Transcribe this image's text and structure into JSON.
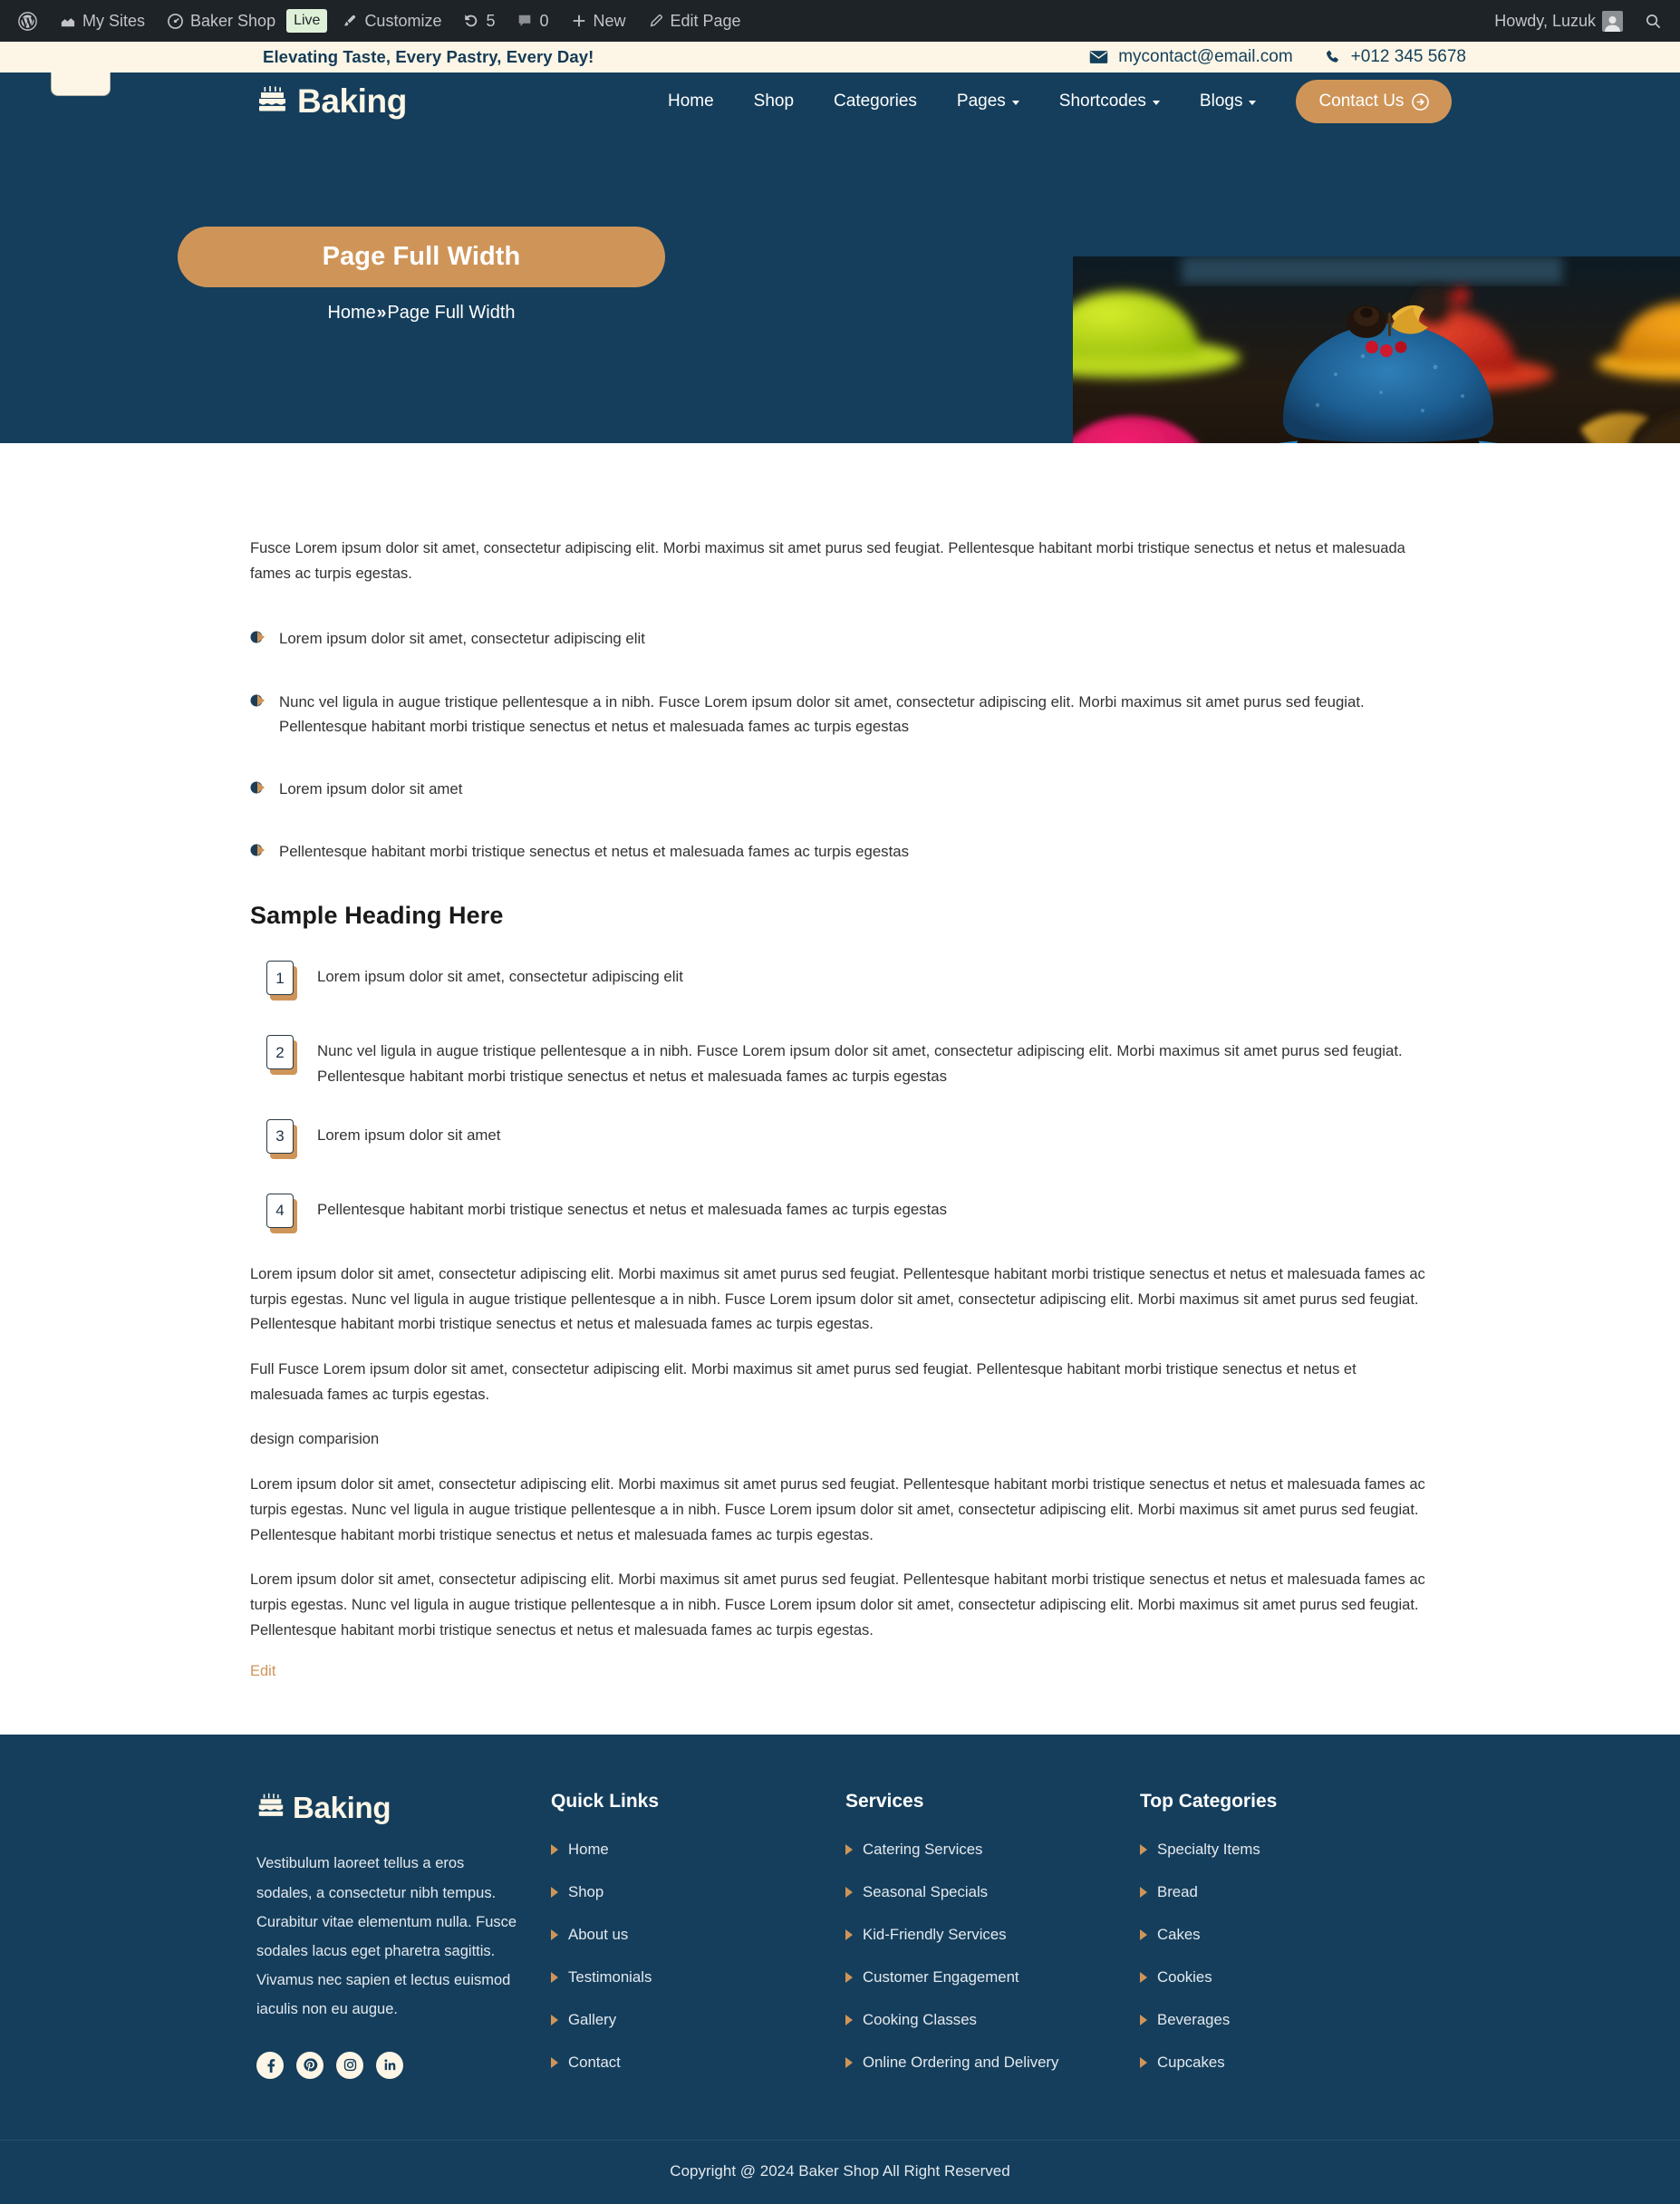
{
  "adminbar": {
    "items": [
      {
        "icon": "wordpress-icon",
        "label": ""
      },
      {
        "icon": "my-sites-icon",
        "label": "My Sites"
      },
      {
        "icon": "site-icon",
        "label": "Baker Shop"
      },
      {
        "icon": "live-badge",
        "label": "Live"
      },
      {
        "icon": "brush-icon",
        "label": "Customize"
      },
      {
        "icon": "updates-icon",
        "label": "5"
      },
      {
        "icon": "comment-icon",
        "label": "0"
      },
      {
        "icon": "plus-icon",
        "label": "New"
      },
      {
        "icon": "pencil-icon",
        "label": "Edit Page"
      }
    ],
    "howdy": "Howdy, Luzuk",
    "search_icon": "search-icon"
  },
  "topbar": {
    "tagline": "Elevating Taste, Every Pastry, Every Day!",
    "email": "mycontact@email.com",
    "phone": "+012 345 5678"
  },
  "header": {
    "brand": "Baking",
    "nav": [
      {
        "label": "Home",
        "has_caret": false
      },
      {
        "label": "Shop",
        "has_caret": false
      },
      {
        "label": "Categories",
        "has_caret": false
      },
      {
        "label": "Pages",
        "has_caret": true
      },
      {
        "label": "Shortcodes",
        "has_caret": true
      },
      {
        "label": "Blogs",
        "has_caret": true
      }
    ],
    "cta": "Contact Us"
  },
  "hero": {
    "title": "Page Full Width",
    "breadcrumb_home": "Home",
    "breadcrumb_sep": "»",
    "breadcrumb_current": "Page Full Width",
    "photo_alt": "colorful-mousse-cakes-photo"
  },
  "content": {
    "intro": "Fusce Lorem ipsum dolor sit amet, consectetur adipiscing elit. Morbi maximus sit amet purus sed feugiat. Pellentesque habitant morbi tristique senectus et netus et malesuada fames ac turpis egestas.",
    "bullets": [
      "Lorem ipsum dolor sit amet, consectetur adipiscing elit",
      "Nunc vel ligula in augue tristique pellentesque a in nibh. Fusce Lorem ipsum dolor sit amet, consectetur adipiscing elit. Morbi maximus sit amet purus sed feugiat. Pellentesque habitant morbi tristique senectus et netus et malesuada fames ac turpis egestas",
      "Lorem ipsum dolor sit amet",
      "Pellentesque habitant morbi tristique senectus et netus et malesuada fames ac turpis egestas"
    ],
    "heading": "Sample Heading Here",
    "numbered": [
      {
        "num": "1",
        "text": "Lorem ipsum dolor sit amet, consectetur adipiscing elit"
      },
      {
        "num": "2",
        "text": "Nunc vel ligula in augue tristique pellentesque a in nibh. Fusce Lorem ipsum dolor sit amet, consectetur adipiscing elit. Morbi maximus sit amet purus sed feugiat. Pellentesque habitant morbi tristique senectus et netus et malesuada fames ac turpis egestas"
      },
      {
        "num": "3",
        "text": "Lorem ipsum dolor sit amet"
      },
      {
        "num": "4",
        "text": "Pellentesque habitant morbi tristique senectus et netus et malesuada fames ac turpis egestas"
      }
    ],
    "paragraphs": [
      "Lorem ipsum dolor sit amet, consectetur adipiscing elit. Morbi maximus sit amet purus sed feugiat. Pellentesque habitant morbi tristique senectus et netus et malesuada fames ac turpis egestas. Nunc vel ligula in augue tristique pellentesque a in nibh. Fusce Lorem ipsum dolor sit amet, consectetur adipiscing elit. Morbi maximus sit amet purus sed feugiat. Pellentesque habitant morbi tristique senectus et netus et malesuada fames ac turpis egestas.",
      "Full Fusce Lorem ipsum dolor sit amet, consectetur adipiscing elit. Morbi maximus sit amet purus sed feugiat. Pellentesque habitant morbi tristique senectus et netus et malesuada fames ac turpis egestas.",
      "design comparision",
      "Lorem ipsum dolor sit amet, consectetur adipiscing elit. Morbi maximus sit amet purus sed feugiat. Pellentesque habitant morbi tristique senectus et netus et malesuada fames ac turpis egestas. Nunc vel ligula in augue tristique pellentesque a in nibh. Fusce Lorem ipsum dolor sit amet, consectetur adipiscing elit. Morbi maximus sit amet purus sed feugiat. Pellentesque habitant morbi tristique senectus et netus et malesuada fames ac turpis egestas.",
      "Lorem ipsum dolor sit amet, consectetur adipiscing elit. Morbi maximus sit amet purus sed feugiat. Pellentesque habitant morbi tristique senectus et netus et malesuada fames ac turpis egestas. Nunc vel ligula in augue tristique pellentesque a in nibh. Fusce Lorem ipsum dolor sit amet, consectetur adipiscing elit. Morbi maximus sit amet purus sed feugiat. Pellentesque habitant morbi tristique senectus et netus et malesuada fames ac turpis egestas."
    ],
    "edit_link": "Edit"
  },
  "footer": {
    "brand": "Baking",
    "about": "Vestibulum laoreet tellus a eros sodales, a consectetur nibh tempus. Curabitur vitae elementum nulla. Fusce sodales lacus eget pharetra sagittis. Vivamus nec sapien et lectus euismod iaculis non eu augue.",
    "socials": [
      "facebook-icon",
      "pinterest-icon",
      "instagram-icon",
      "linkedin-icon"
    ],
    "columns": [
      {
        "title": "Quick Links",
        "links": [
          "Home",
          "Shop",
          "About us",
          "Testimonials",
          "Gallery",
          "Contact"
        ]
      },
      {
        "title": "Services",
        "links": [
          "Catering Services",
          "Seasonal Specials",
          "Kid-Friendly Services",
          "Customer Engagement",
          "Cooking Classes",
          "Online Ordering and Delivery"
        ]
      },
      {
        "title": "Top Categories",
        "links": [
          "Specialty Items",
          "Bread",
          "Cakes",
          "Cookies",
          "Beverages",
          "Cupcakes"
        ]
      }
    ],
    "copyright": "Copyright @ 2024 Baker Shop All Right Reserved"
  },
  "colors": {
    "navy": "#153e5c",
    "tan": "#cf9558",
    "cream": "#fdf6e6",
    "admin": "#1d2327"
  }
}
